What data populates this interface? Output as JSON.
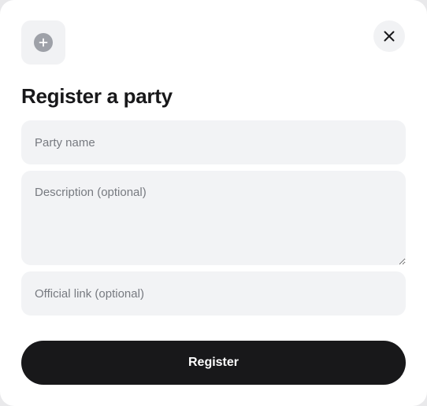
{
  "modal": {
    "header_icon": "plus-circle-icon",
    "close_icon": "close-icon",
    "title": "Register a party",
    "fields": {
      "party_name": {
        "value": "",
        "placeholder": "Party name"
      },
      "description": {
        "value": "",
        "placeholder": "Description (optional)"
      },
      "official_link": {
        "value": "",
        "placeholder": "Official link (optional)"
      }
    },
    "submit_label": "Register"
  },
  "colors": {
    "background": "#ffffff",
    "field_background": "#f2f3f5",
    "primary_button": "#18181a",
    "icon_gray": "#9ea1a8"
  }
}
